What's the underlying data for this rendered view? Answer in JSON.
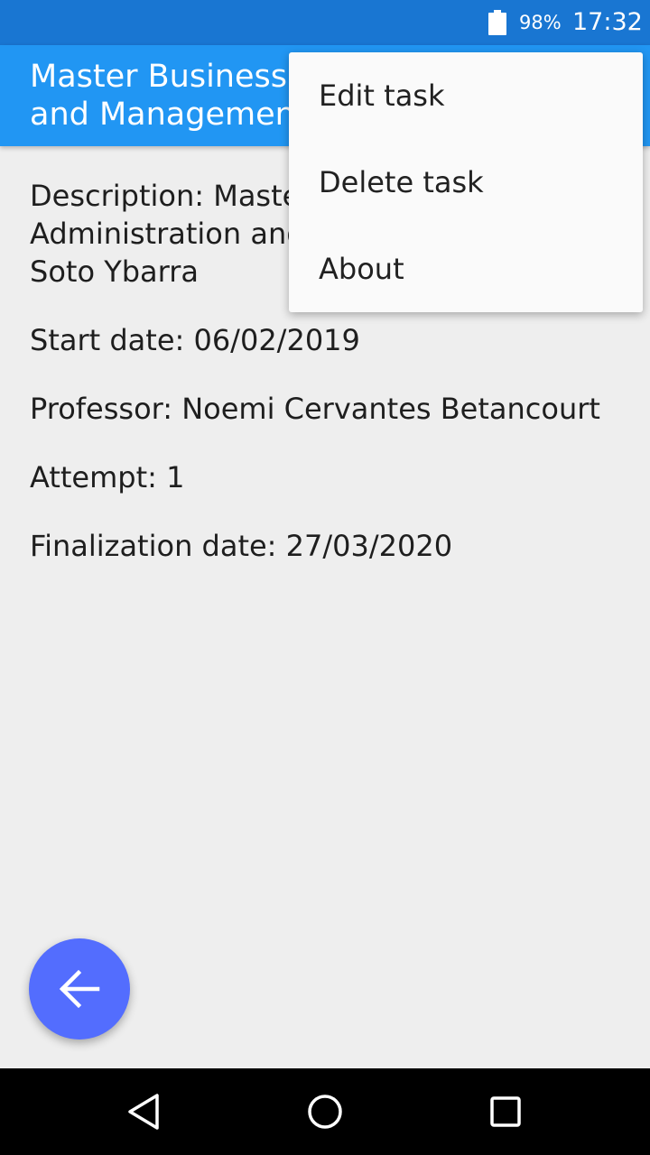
{
  "status_bar": {
    "battery": "98%",
    "time": "17:32",
    "battery_icon": "battery-icon"
  },
  "app_bar": {
    "title": "Master Business Administration\nand Management"
  },
  "details": {
    "description": "Description: Master Business Administration and Management, Andres Soto Ybarra",
    "start_date": "Start date: 06/02/2019",
    "professor": "Professor: Noemi Cervantes Betancourt",
    "attempt": "Attempt: 1",
    "finalization_date": "Finalization date: 27/03/2020"
  },
  "menu": {
    "items": [
      {
        "label": "Edit task"
      },
      {
        "label": "Delete task"
      },
      {
        "label": "About"
      }
    ]
  },
  "fab": {
    "icon": "arrow-back-icon"
  },
  "nav_bar": {
    "back_icon": "nav-back-icon",
    "home_icon": "nav-home-icon",
    "recent_icon": "nav-recent-icon"
  },
  "colors": {
    "status_bar": "#1976d2",
    "app_bar": "#2196f3",
    "fab": "#536dfe",
    "background": "#eeeeee"
  }
}
